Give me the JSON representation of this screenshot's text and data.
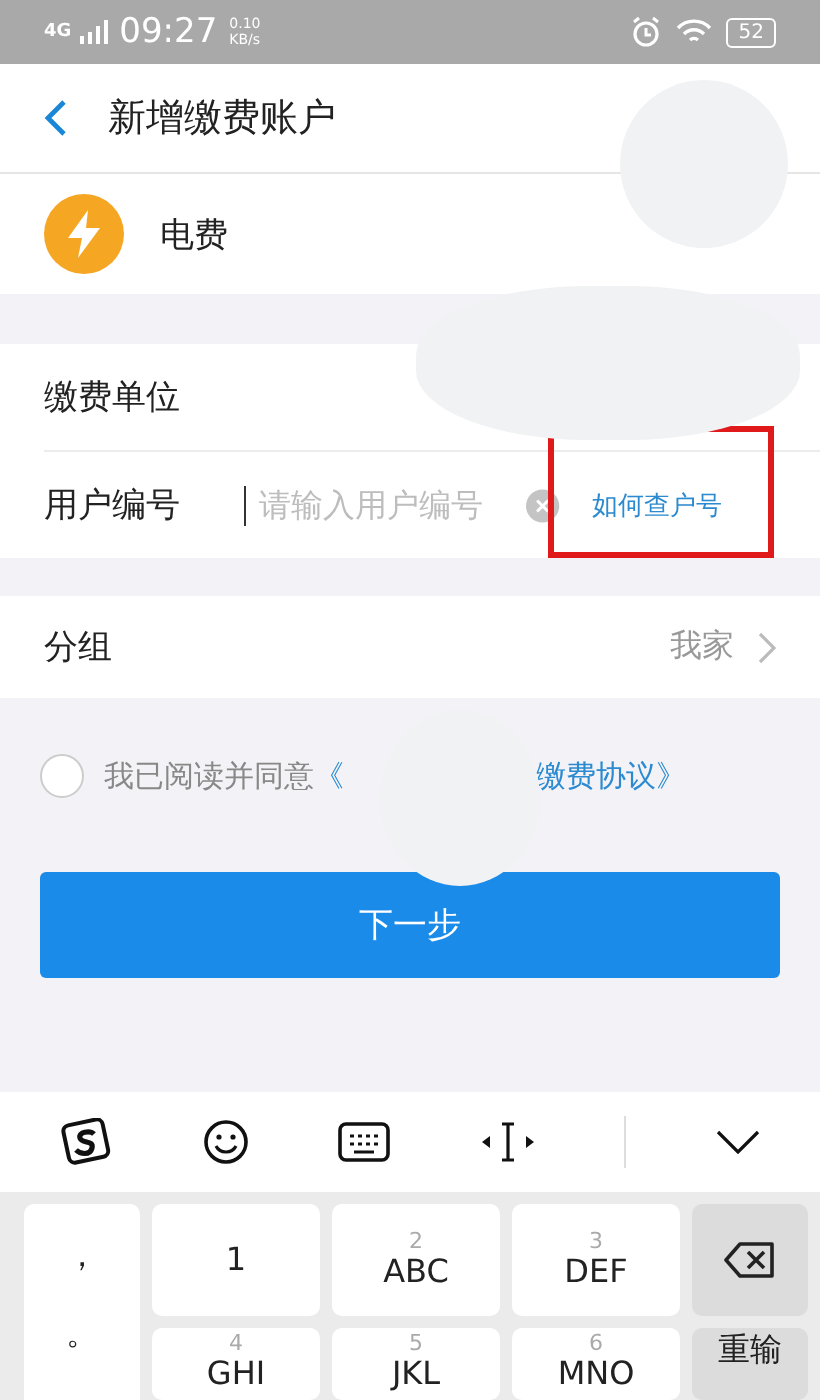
{
  "status_bar": {
    "network": "4G",
    "time": "09:27",
    "speed": "0.10",
    "speed_unit": "KB/s",
    "battery": "52"
  },
  "header": {
    "title": "新增缴费账户"
  },
  "bill_type": {
    "label": "电费"
  },
  "form": {
    "rows": [
      {
        "kind": "text",
        "label": "缴费单位"
      },
      {
        "kind": "input",
        "label": "用户编号",
        "placeholder": "请输入用户编号",
        "help_link": "如何查户号",
        "highlighted": true
      }
    ]
  },
  "group": {
    "label": "分组",
    "value": "我家"
  },
  "agreement": {
    "checked": false,
    "text": "我已阅读并同意",
    "link_start": "《",
    "link_end": "缴费协议》"
  },
  "next_button": "下一步",
  "keyboard": {
    "symbols": [
      "，",
      "。"
    ],
    "keys": [
      {
        "main": "1"
      },
      {
        "digit": "2",
        "main": "ABC"
      },
      {
        "digit": "3",
        "main": "DEF"
      },
      {
        "kind": "delete"
      },
      {
        "digit": "4",
        "main": "GHI"
      },
      {
        "digit": "5",
        "main": "JKL"
      },
      {
        "digit": "6",
        "main": "MNO"
      },
      {
        "kind": "action",
        "main": "重输"
      }
    ]
  }
}
